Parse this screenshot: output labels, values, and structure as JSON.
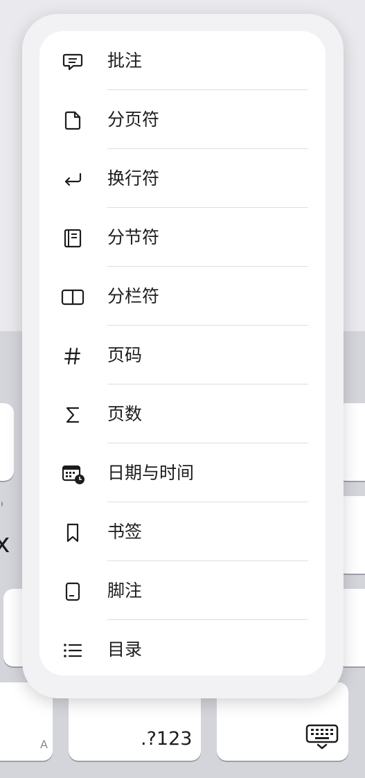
{
  "menu": {
    "items": [
      {
        "label": "批注",
        "icon": "comment-icon"
      },
      {
        "label": "分页符",
        "icon": "page-break-icon"
      },
      {
        "label": "换行符",
        "icon": "line-break-icon"
      },
      {
        "label": "分节符",
        "icon": "section-break-icon"
      },
      {
        "label": "分栏符",
        "icon": "column-break-icon"
      },
      {
        "label": "页码",
        "icon": "hash-icon"
      },
      {
        "label": "页数",
        "icon": "sigma-icon"
      },
      {
        "label": "日期与时间",
        "icon": "calendar-clock-icon"
      },
      {
        "label": "书签",
        "icon": "bookmark-icon"
      },
      {
        "label": "脚注",
        "icon": "footnote-icon"
      },
      {
        "label": "目录",
        "icon": "list-icon"
      }
    ]
  },
  "keyboard": {
    "numbers_key": ".?123",
    "left_key_hint": "A",
    "partial_letter": "x",
    "apostrophe": "'"
  }
}
